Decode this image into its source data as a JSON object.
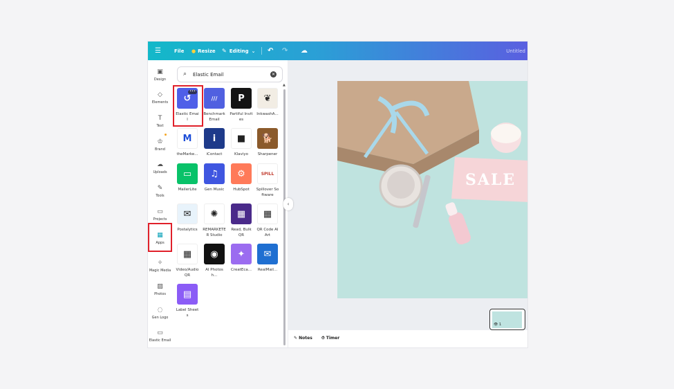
{
  "topbar": {
    "file": "File",
    "resize": "Resize",
    "editing": "Editing",
    "title": "Untitled"
  },
  "rail": [
    {
      "label": "Design",
      "icon": "design-icon"
    },
    {
      "label": "Elements",
      "icon": "elements-icon"
    },
    {
      "label": "Text",
      "icon": "text-icon"
    },
    {
      "label": "Brand",
      "icon": "brand-icon"
    },
    {
      "label": "Uploads",
      "icon": "uploads-icon"
    },
    {
      "label": "Tools",
      "icon": "tools-icon"
    },
    {
      "label": "Projects",
      "icon": "projects-icon"
    },
    {
      "label": "Apps",
      "icon": "apps-icon"
    },
    {
      "label": "Magic Media",
      "icon": "magic-media-icon"
    },
    {
      "label": "Photos",
      "icon": "photos-icon"
    },
    {
      "label": "Gen Logo",
      "icon": "gen-logo-icon"
    },
    {
      "label": "Elastic Email",
      "icon": "elastic-email-icon"
    }
  ],
  "search": {
    "value": "Elastic Email"
  },
  "apps": [
    {
      "label": "Elastic Email",
      "color": "#4f5fe8",
      "glyph": "↺"
    },
    {
      "label": "Benchmark Email",
      "color": "#5060e0",
      "glyph": "///"
    },
    {
      "label": "Partiful Invites",
      "color": "#141414",
      "glyph": "P"
    },
    {
      "label": "InkwashA...",
      "color": "#f2ede4",
      "glyph": "❦"
    },
    {
      "label": "theMarke...",
      "color": "#ffffff",
      "glyph": "M"
    },
    {
      "label": "iContact",
      "color": "#1e3a8a",
      "glyph": "i"
    },
    {
      "label": "Klaviyo",
      "color": "#ffffff",
      "glyph": "■"
    },
    {
      "label": "Sharpener",
      "color": "#8b5a2b",
      "glyph": "🐕"
    },
    {
      "label": "MailerLite",
      "color": "#09c269",
      "glyph": "▭"
    },
    {
      "label": "Gen Music",
      "color": "#3f56e0",
      "glyph": "♫"
    },
    {
      "label": "HubSpot",
      "color": "#ff7a59",
      "glyph": "⚙"
    },
    {
      "label": "Spillover Software",
      "color": "#ffffff",
      "glyph": "SPILL"
    },
    {
      "label": "Postalytics",
      "color": "#e8f3fb",
      "glyph": "✉"
    },
    {
      "label": "REMARKETER Studio",
      "color": "#ffffff",
      "glyph": "✺"
    },
    {
      "label": "Read, Bulk QR",
      "color": "#4a2a8a",
      "glyph": "▦"
    },
    {
      "label": "QR Code AI Art",
      "color": "#ffffff",
      "glyph": "▦"
    },
    {
      "label": "Video/Audio QR",
      "color": "#ffffff",
      "glyph": "▦"
    },
    {
      "label": "AI Photosh...",
      "color": "#111111",
      "glyph": "◉"
    },
    {
      "label": "CreatEca...",
      "color": "#9b6cf0",
      "glyph": "✦"
    },
    {
      "label": "RealMail...",
      "color": "#1f6fd1",
      "glyph": "✉"
    },
    {
      "label": "Label Sheets",
      "color": "#8b5cf6",
      "glyph": "▤"
    }
  ],
  "footer": {
    "notes": "Notes",
    "timer": "Timer",
    "page_count": "1"
  },
  "canvas": {
    "sale_text": "SALE"
  }
}
